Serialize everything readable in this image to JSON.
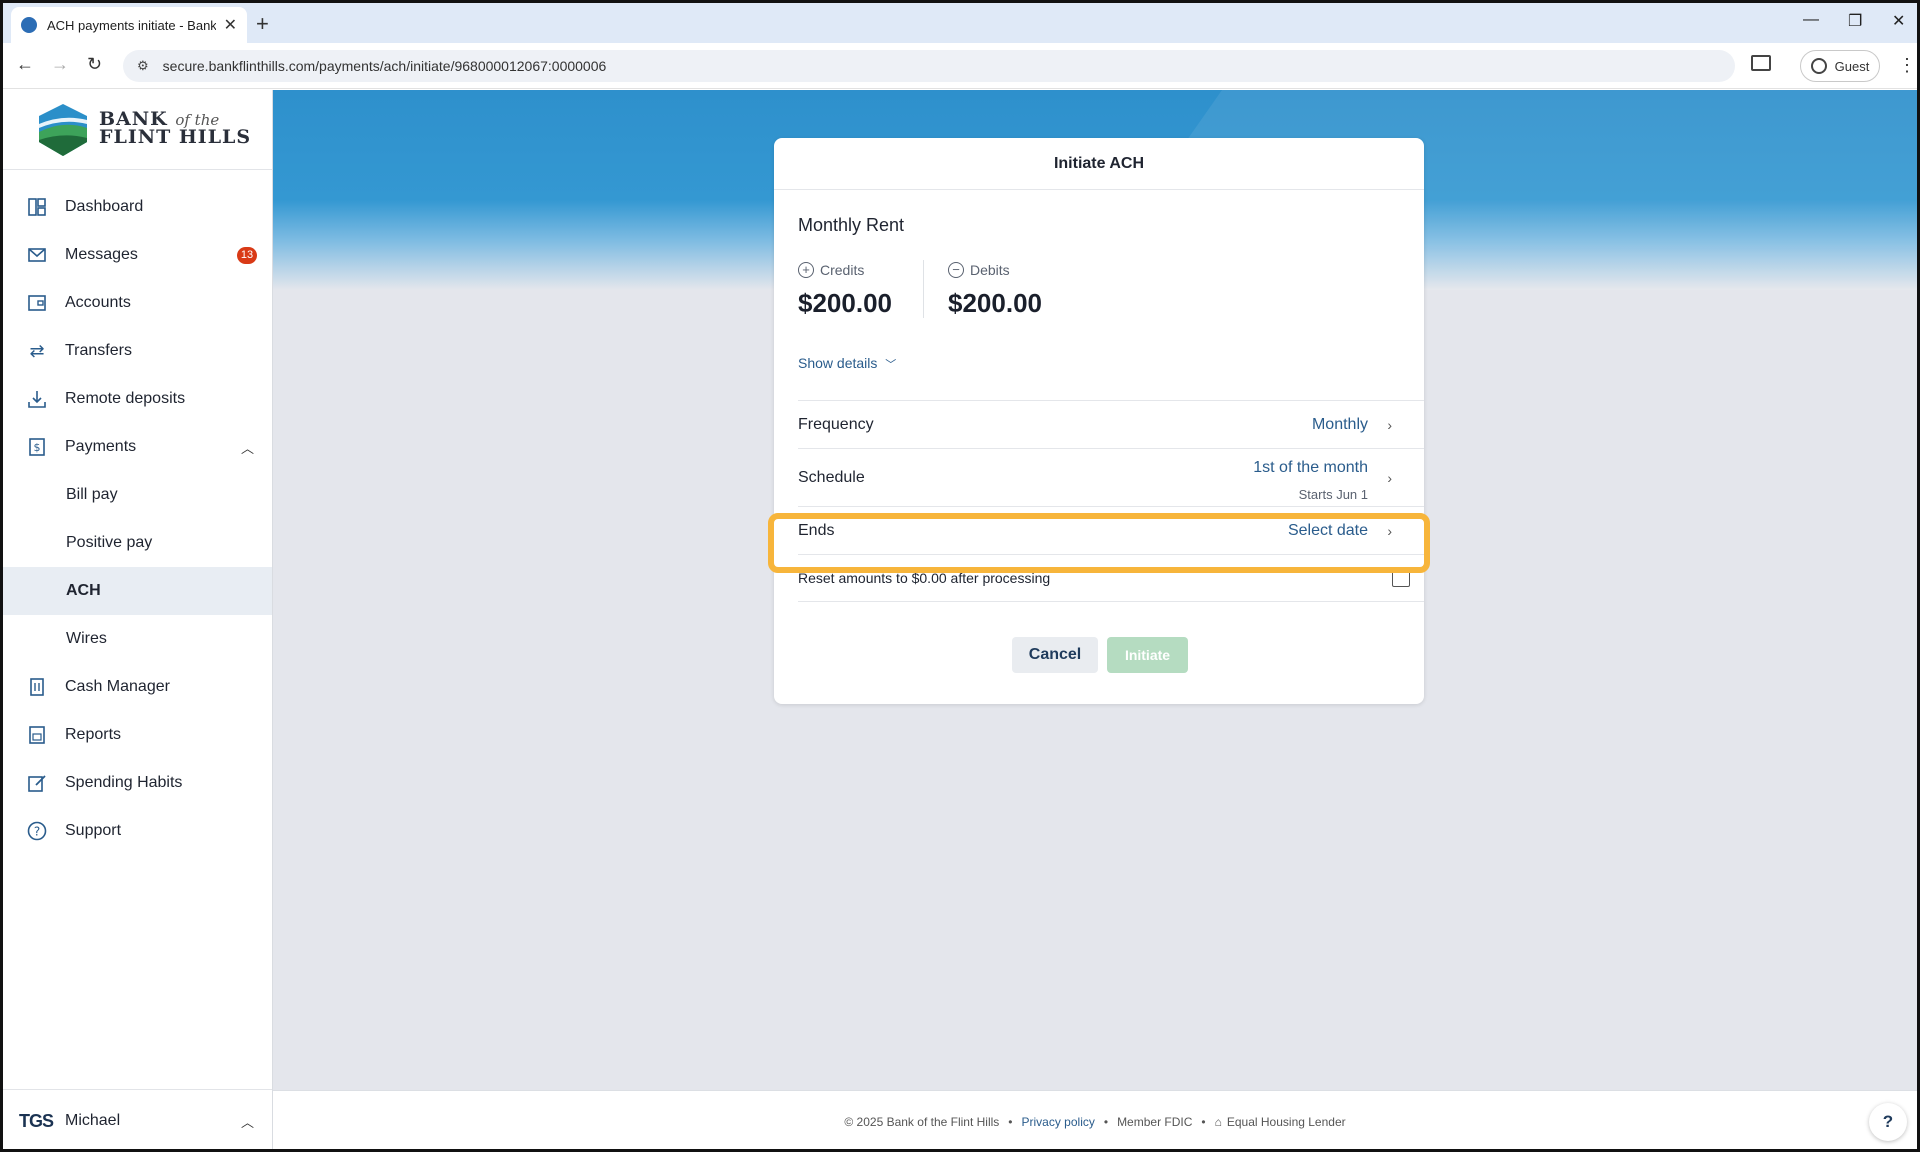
{
  "browser": {
    "tab_title": "ACH payments initiate - Bank of",
    "url": "secure.bankflinthills.com/payments/ach/initiate/968000012067:0000006",
    "profile_label": "Guest"
  },
  "logo": {
    "line1": "BANK",
    "line1_italic": "of the",
    "line2": "FLINT HILLS"
  },
  "sidebar": {
    "items": [
      {
        "label": "Dashboard",
        "icon": "dashboard-icon"
      },
      {
        "label": "Messages",
        "icon": "mail-icon",
        "badge": "13"
      },
      {
        "label": "Accounts",
        "icon": "wallet-icon"
      },
      {
        "label": "Transfers",
        "icon": "transfer-icon"
      },
      {
        "label": "Remote deposits",
        "icon": "download-icon"
      },
      {
        "label": "Payments",
        "icon": "dollar-icon"
      },
      {
        "label": "Bill pay"
      },
      {
        "label": "Positive pay"
      },
      {
        "label": "ACH"
      },
      {
        "label": "Wires"
      },
      {
        "label": "Cash Manager",
        "icon": "building-icon"
      },
      {
        "label": "Reports",
        "icon": "report-icon"
      },
      {
        "label": "Spending Habits",
        "icon": "edit-icon"
      },
      {
        "label": "Support",
        "icon": "help-icon"
      }
    ],
    "user": {
      "initials": "TGS",
      "name": "Michael"
    }
  },
  "modal": {
    "title": "Initiate ACH",
    "payment_name": "Monthly Rent",
    "credits_label": "Credits",
    "credits_value": "$200.00",
    "debits_label": "Debits",
    "debits_value": "$200.00",
    "show_details": "Show details",
    "frequency_label": "Frequency",
    "frequency_value": "Monthly",
    "schedule_label": "Schedule",
    "schedule_value": "1st of the month",
    "schedule_sub": "Starts Jun 1",
    "ends_label": "Ends",
    "ends_value": "Select date",
    "reset_label": "Reset amounts to $0.00 after processing",
    "reset_checked": false,
    "cancel_label": "Cancel",
    "initiate_label": "Initiate"
  },
  "footer": {
    "copyright": "© 2025 Bank of the Flint Hills",
    "privacy": "Privacy policy",
    "fdic": "Member FDIC",
    "housing": "Equal Housing Lender",
    "help": "?"
  },
  "colors": {
    "accent": "#2a5c8c",
    "highlight": "#f7b53b",
    "badge": "#d93a16",
    "banner": "#3498d2"
  }
}
